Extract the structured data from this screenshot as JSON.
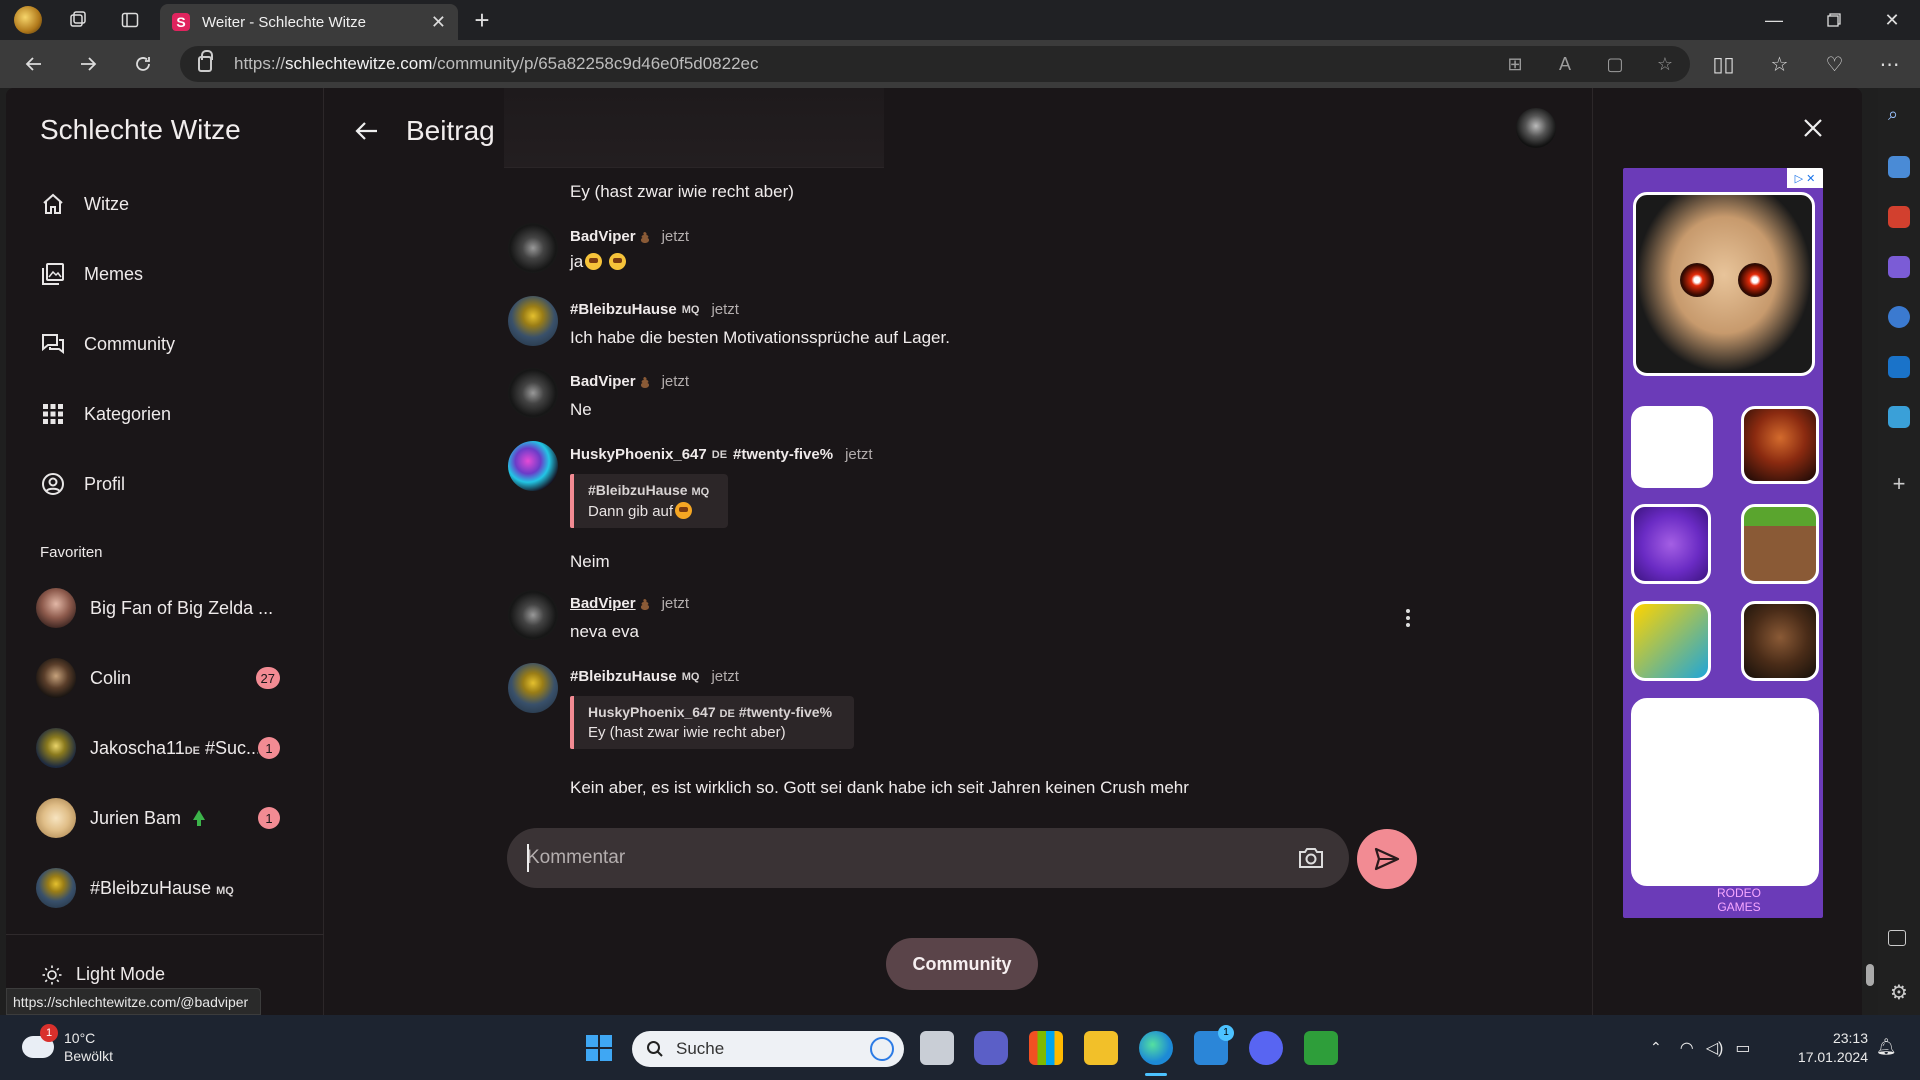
{
  "browser": {
    "tab_title": "Weiter - Schlechte Witze",
    "tab_favicon_letter": "S",
    "url_prefix": "https://",
    "url_domain": "schlechtewitze.com",
    "url_path": "/community/p/65a82258c9d46e0f5d0822ec"
  },
  "sidebar": {
    "brand": "Schlechte Witze",
    "nav": [
      {
        "label": "Witze",
        "icon": "home-icon"
      },
      {
        "label": "Memes",
        "icon": "image-gallery-icon"
      },
      {
        "label": "Community",
        "icon": "chat-bubbles-icon"
      },
      {
        "label": "Kategorien",
        "icon": "grid-icon"
      },
      {
        "label": "Profil",
        "icon": "user-circle-icon"
      }
    ],
    "favorites_heading": "Favoriten",
    "favorites": [
      {
        "name": "Big Fan of Big Zelda ...",
        "badge": ""
      },
      {
        "name": "Colin",
        "badge": "27"
      },
      {
        "name": "Jakoscha11",
        "tag": "DE",
        "suffix": " #Suc...",
        "badge": "1"
      },
      {
        "name": "Jurien Bam",
        "badge": "1"
      },
      {
        "name": "#BleibzuHause",
        "tag": "MQ",
        "badge": ""
      }
    ],
    "light_mode_label": "Light Mode"
  },
  "status_bar_url": "https://schlechtewitze.com/@badviper",
  "post": {
    "title": "Beitrag",
    "messages": [
      {
        "text": "Ey (hast zwar iwie recht aber)"
      },
      {
        "author": "BadViper",
        "time": "jetzt",
        "text": "ja"
      },
      {
        "author": "#BleibzuHause",
        "tag": "MQ",
        "time": "jetzt",
        "text": "Ich habe die besten Motivationssprüche auf Lager."
      },
      {
        "author": "BadViper",
        "time": "jetzt",
        "text": "Ne"
      },
      {
        "author": "HuskyPhoenix_647",
        "tag": "DE",
        "extra": "#twenty-five%",
        "time": "jetzt",
        "quote_author": "#BleibzuHause",
        "quote_tag": "MQ",
        "quote_text": "Dann gib auf",
        "text": "Neim"
      },
      {
        "author": "BadViper",
        "time": "jetzt",
        "text": "neva eva"
      },
      {
        "author": "#BleibzuHause",
        "tag": "MQ",
        "time": "jetzt",
        "quote_author": "HuskyPhoenix_647",
        "quote_tag": "DE",
        "quote_extra": "#twenty-five%",
        "quote_text": "Ey (hast zwar iwie recht aber)",
        "text": "Kein aber, es ist wirklich so. Gott sei dank habe ich seit Jahren keinen Crush mehr"
      }
    ],
    "comment_placeholder": "Kommentar",
    "community_button": "Community"
  },
  "ad": {
    "badge": "▷ ✕",
    "footer": "RODEO GAMES"
  },
  "taskbar": {
    "weather_temp": "10°C",
    "weather_desc": "Bewölkt",
    "weather_badge": "1",
    "search_label": "Suche",
    "mail_badge": "1",
    "time": "23:13",
    "date": "17.01.2024"
  },
  "colors": {
    "accent": "#f28b93",
    "page_bg": "#1a1618",
    "button_bg": "#5a4449"
  }
}
